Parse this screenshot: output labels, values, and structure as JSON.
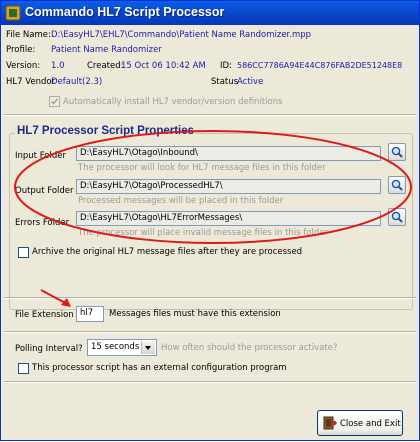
{
  "window": {
    "title": "Commando HL7 Script Processor"
  },
  "info": {
    "file_name_label": "File Name:",
    "file_name": "D:\\EasyHL7\\EHL7\\Commando\\Patient Name Randomizer.mpp",
    "profile_label": "Profile:",
    "profile": "Patient Name Randomizer",
    "version_label": "Version:",
    "version": "1.0",
    "created_label": "Created:",
    "created": "15 Oct 06 10:42 AM",
    "id_label": "ID:",
    "id": "586CC7786A94E44C876FAB2DE51248E8",
    "vendor_label": "HL7 Vendor",
    "vendor": "Default(2.3)",
    "status_label": "Status",
    "status": "Active",
    "auto_install_label": "Automatically install HL7 vendor/version definitions"
  },
  "properties": {
    "title": "HL7 Processor Script Properties",
    "input_label": "Input Folder",
    "input_value": "D:\\EasyHL7\\Otago\\Inbound\\",
    "input_hint": "The processor will look for HL7 message files in this folder",
    "output_label": "Output Folder",
    "output_value": "D:\\EasyHL7\\Otago\\ProcessedHL7\\",
    "output_hint": "Processed messages will be placed in this folder",
    "errors_label": "Errors Folder",
    "errors_value": "D:\\EasyHL7\\Otago\\HL7ErrorMessages\\",
    "errors_hint": "The processor will place invalid message files in this folder",
    "archive_label": "Archive the original HL7 message files after they are processed"
  },
  "extension": {
    "label": "File Extension",
    "value": "hl7",
    "hint": "Messages files must have this extension"
  },
  "polling": {
    "label": "Polling Interval?",
    "value": "15 seconds",
    "hint": "How often should the processor activate?",
    "external_config_label": "This processor script has an external configuration program"
  },
  "buttons": {
    "close_exit": "Close and Exit"
  },
  "colors": {
    "annotation": "#e01818",
    "title_bar": "#0a52d8",
    "label_blue": "#1c1ca8"
  },
  "icons": [
    "app-icon",
    "search-icon",
    "close-exit-icon"
  ]
}
